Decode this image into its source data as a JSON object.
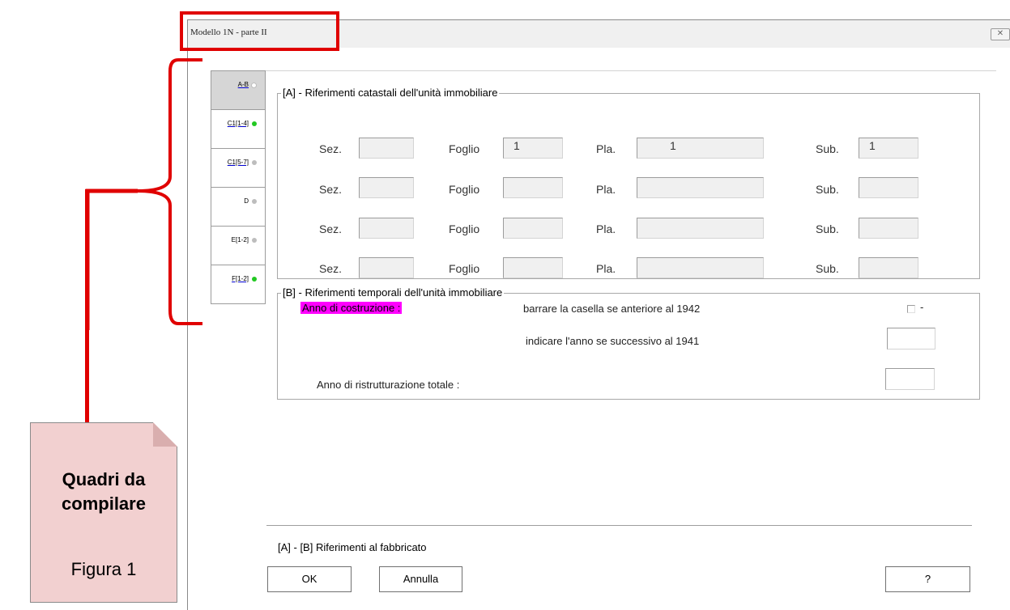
{
  "window": {
    "title": "Modello 1N -   parte II",
    "close_icon": "close-icon"
  },
  "tabs": [
    {
      "label": "A-B",
      "status": "empty",
      "color": "#ffffff",
      "selected": true
    },
    {
      "label": "C1[1-4]",
      "status": "filled",
      "color": "#22c822",
      "selected": false
    },
    {
      "label": "C1[5-7]",
      "status": "empty",
      "color": "#bdbdbd",
      "selected": false
    },
    {
      "label": "D",
      "status": "empty",
      "color": "#bdbdbd",
      "selected": false
    },
    {
      "label": "E[1-2]",
      "status": "empty",
      "color": "#bdbdbd",
      "selected": false
    },
    {
      "label": "F[1-2]",
      "status": "filled",
      "color": "#22c822",
      "selected": false
    }
  ],
  "section_a": {
    "legend": "[A] - Riferimenti catastali dell'unità immobiliare",
    "labels": {
      "sez": "Sez.",
      "foglio": "Foglio",
      "pla": "Pla.",
      "sub": "Sub."
    },
    "rows": [
      {
        "sez": "",
        "foglio": "1",
        "pla": "1",
        "sub": "1"
      },
      {
        "sez": "",
        "foglio": "",
        "pla": "",
        "sub": ""
      },
      {
        "sez": "",
        "foglio": "",
        "pla": "",
        "sub": ""
      },
      {
        "sez": "",
        "foglio": "",
        "pla": "",
        "sub": ""
      }
    ]
  },
  "section_b": {
    "legend": "[B] - Riferimenti temporali dell'unità immobiliare",
    "anno_costruzione_label": "Anno di costruzione :",
    "barrare_text": "barrare la casella se anteriore al 1942",
    "checkbox_suffix": "-",
    "indicare_text": "indicare l'anno se successivo al 1941",
    "anno_costruzione_value": "",
    "ristrutturazione_label": "Anno di ristrutturazione totale :",
    "ristrutturazione_value": ""
  },
  "footer": {
    "caption": "[A] - [B] Riferimenti al fabbricato",
    "ok": "OK",
    "annulla": "Annulla",
    "help": "?"
  },
  "annotation": {
    "title": "Quadri da compilare",
    "figure": "Figura 1",
    "color": "#e00000"
  }
}
